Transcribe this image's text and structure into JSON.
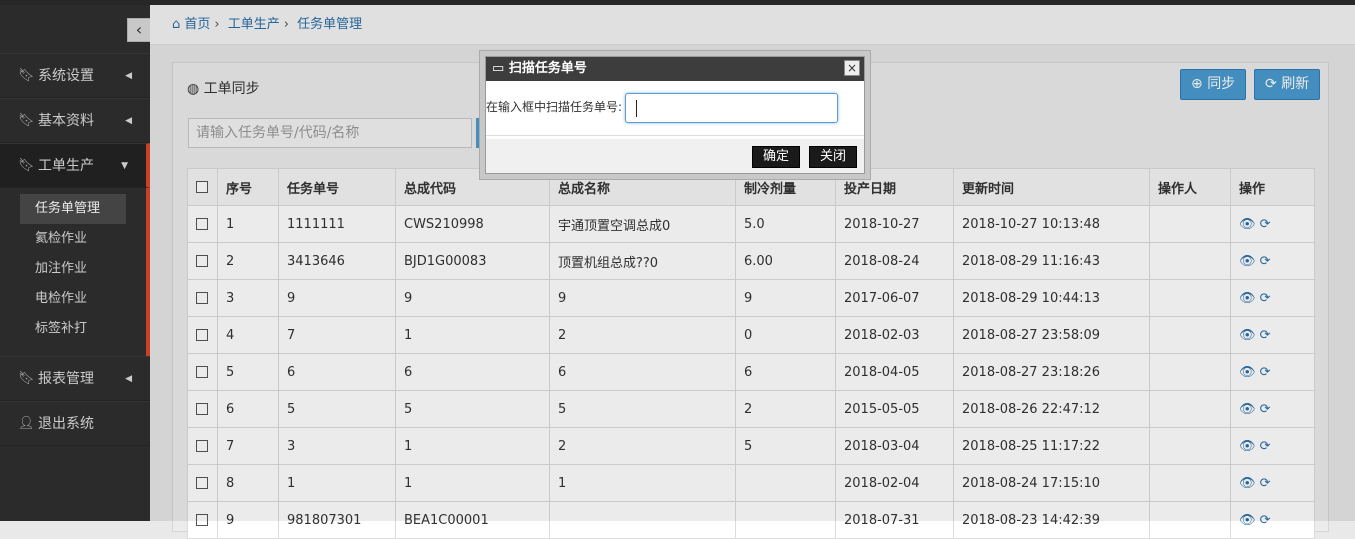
{
  "sidebar": {
    "items": [
      {
        "label": "系统设置",
        "icon": "bookmark-icon",
        "arrow": "◀"
      },
      {
        "label": "基本资料",
        "icon": "bookmark-icon",
        "arrow": "◀"
      },
      {
        "label": "工单生产",
        "icon": "bookmark-icon",
        "arrow": "▼"
      },
      {
        "label": "报表管理",
        "icon": "bookmark-icon",
        "arrow": "◀"
      },
      {
        "label": "退出系统",
        "icon": "user-icon"
      }
    ],
    "subitems": [
      "任务单管理",
      "氦检作业",
      "加注作业",
      "电检作业",
      "标签补打"
    ]
  },
  "breadcrumb": {
    "home": "首页",
    "level1": "工单生产",
    "level2": "任务单管理"
  },
  "panel": {
    "title": "工单同步",
    "sync_label": "同步",
    "refresh_label": "刷新",
    "search_placeholder": "请输入任务单号/代码/名称"
  },
  "table": {
    "headers": [
      "序号",
      "任务单号",
      "总成代码",
      "总成名称",
      "制冷剂量",
      "投产日期",
      "更新时间",
      "操作人",
      "操作"
    ],
    "rows": [
      [
        "1",
        "1111111",
        "CWS210998",
        "宇通顶置空调总成0",
        "5.0",
        "2018-10-27",
        "2018-10-27 10:13:48",
        ""
      ],
      [
        "2",
        "3413646",
        "BJD1G00083",
        "顶置机组总成??0",
        "6.00",
        "2018-08-24",
        "2018-08-29 11:16:43",
        ""
      ],
      [
        "3",
        "9",
        "9",
        "9",
        "9",
        "2017-06-07",
        "2018-08-29 10:44:13",
        ""
      ],
      [
        "4",
        "7",
        "1",
        "2",
        "0",
        "2018-02-03",
        "2018-08-27 23:58:09",
        ""
      ],
      [
        "5",
        "6",
        "6",
        "6",
        "6",
        "2018-04-05",
        "2018-08-27 23:18:26",
        ""
      ],
      [
        "6",
        "5",
        "5",
        "5",
        "2",
        "2015-05-05",
        "2018-08-26 22:47:12",
        ""
      ],
      [
        "7",
        "3",
        "1",
        "2",
        "5",
        "2018-03-04",
        "2018-08-25 11:17:22",
        ""
      ],
      [
        "8",
        "1",
        "1",
        "1",
        "",
        "2018-02-04",
        "2018-08-24 17:15:10",
        ""
      ],
      [
        "9",
        "981807301",
        "BEA1C00001",
        "",
        "",
        "2018-07-31",
        "2018-08-23 14:42:39",
        ""
      ]
    ]
  },
  "dialog": {
    "title": "扫描任务单号",
    "label": "在输入框中扫描任务单号:",
    "input_value": "",
    "ok_label": "确定",
    "close_label": "关闭"
  }
}
